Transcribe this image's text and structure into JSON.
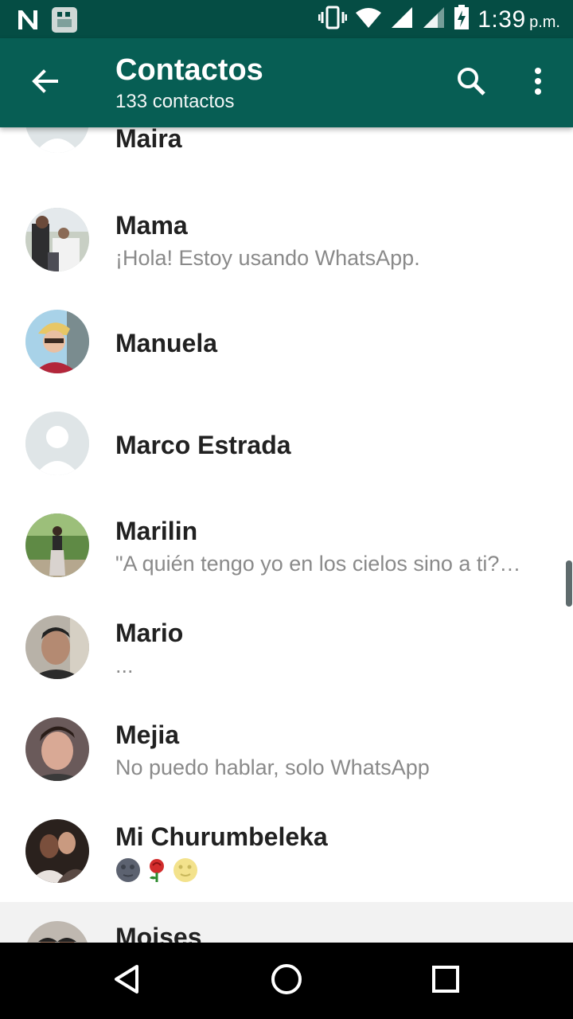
{
  "status_bar": {
    "time": "1:39",
    "ampm": "p.m.",
    "icons": [
      "nfc-icon",
      "notification-icon",
      "vibrate-icon",
      "wifi-icon",
      "signal-icon",
      "signal-icon-2",
      "battery-charging-icon"
    ]
  },
  "app_bar": {
    "title": "Contactos",
    "subtitle": "133 contactos",
    "back_icon": "arrow-back-icon",
    "search_icon": "search-icon",
    "menu_icon": "more-vert-icon"
  },
  "contacts": [
    {
      "name": "Maira",
      "status": "",
      "avatar": "default-avatar"
    },
    {
      "name": "Mama",
      "status": "¡Hola! Estoy usando WhatsApp.",
      "avatar": "photo"
    },
    {
      "name": "Manuela",
      "status": "",
      "avatar": "photo"
    },
    {
      "name": "Marco Estrada",
      "status": "",
      "avatar": "default-avatar"
    },
    {
      "name": "Marilin",
      "status": "\"A quién tengo yo en los cielos sino a ti?…",
      "avatar": "photo"
    },
    {
      "name": "Mario",
      "status": "...",
      "avatar": "photo"
    },
    {
      "name": "Mejia",
      "status": "No puedo hablar, solo WhatsApp",
      "avatar": "photo"
    },
    {
      "name": "Mi Churumbeleka",
      "status": "",
      "avatar": "photo",
      "emojis": [
        "moon-face-icon",
        "rose-icon",
        "full-moon-face-icon"
      ]
    },
    {
      "name": "Moises",
      "status": "",
      "avatar": "photo"
    }
  ],
  "nav_bar": {
    "back": "nav-back-icon",
    "home": "nav-home-icon",
    "recents": "nav-recents-icon"
  },
  "colors": {
    "app_bar": "#075e54",
    "status_bar": "#054d44",
    "name_text": "#212121",
    "status_text": "#8a8a8a"
  }
}
